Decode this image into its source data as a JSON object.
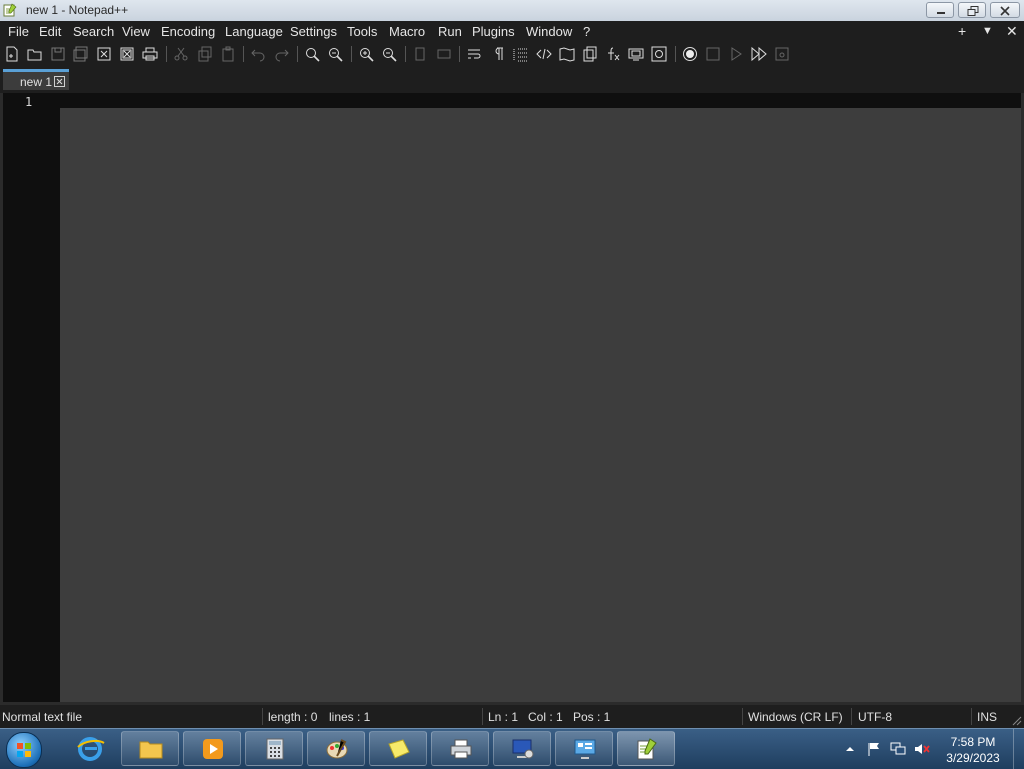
{
  "window": {
    "title": "new 1 - Notepad++"
  },
  "menu": {
    "items": [
      "File",
      "Edit",
      "Search",
      "View",
      "Encoding",
      "Language",
      "Settings",
      "Tools",
      "Macro",
      "Run",
      "Plugins",
      "Window",
      "?"
    ],
    "right_controls": [
      "+",
      "▼",
      "✕"
    ]
  },
  "tabs": [
    {
      "label": "new 1"
    }
  ],
  "editor": {
    "line_numbers": [
      "1"
    ]
  },
  "status": {
    "file_type": "Normal text file",
    "length": "length : 0",
    "lines": "lines : 1",
    "ln": "Ln : 1",
    "col": "Col : 1",
    "pos": "Pos : 1",
    "eol": "Windows (CR LF)",
    "encoding": "UTF-8",
    "mode": "INS"
  },
  "taskbar": {
    "time": "7:58 PM",
    "date": "3/29/2023"
  },
  "colors": {
    "tab_accent": "#5aa0d6",
    "editor_bg": "#3d3d3d",
    "chrome_bg": "#1e1e1e"
  }
}
